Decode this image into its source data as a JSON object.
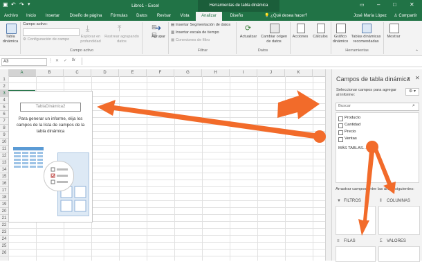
{
  "titlebar": {
    "title": "Libro1 - Excel",
    "context": "Herramientas de tabla dinámica"
  },
  "tabs": [
    "Archivo",
    "Inicio",
    "Insertar",
    "Diseño de página",
    "Fórmulas",
    "Datos",
    "Revisar",
    "Vista",
    "Analizar",
    "Diseño"
  ],
  "active_tab": "Analizar",
  "tell_me": "¿Qué desea hacer?",
  "user": "José María López",
  "share": "Compartir",
  "ribbon": {
    "pivot_label": "Tabla dinámica",
    "active_field_title": "Campo activo:",
    "field_settings": "Configuración de campo",
    "explore_in": "Explorar en profundidad",
    "drill_up": "Rastrear agrupando datos",
    "group_active_field": "Campo activo",
    "group_btn": "Agrupar",
    "insert_slicer": "Insertar Segmentación de datos",
    "insert_timeline": "Insertar escala de tiempo",
    "filter_connections": "Conexiones de filtro",
    "group_filter": "Filtrar",
    "refresh": "Actualizar",
    "change_source": "Cambiar origen de datos",
    "group_data": "Datos",
    "actions": "Acciones",
    "calculations": "Cálculos",
    "pivot_chart": "Gráfico dinámico",
    "recommended": "Tablas dinámicas recomendadas",
    "group_tools": "Herramientas",
    "show": "Mostrar"
  },
  "namebox": "A3",
  "fx": "fx",
  "columns": [
    "A",
    "B",
    "C",
    "D",
    "E",
    "F",
    "G",
    "H",
    "I",
    "J",
    "K"
  ],
  "rows": [
    "1",
    "2",
    "3",
    "4",
    "5",
    "6",
    "7",
    "8",
    "9",
    "10",
    "11",
    "12",
    "13",
    "14",
    "15",
    "16",
    "17",
    "18",
    "19",
    "20",
    "21",
    "22",
    "23",
    "24",
    "25",
    "26"
  ],
  "selected_col": "A",
  "selected_row": "3",
  "pivot": {
    "name": "TablaDinámica2",
    "message": "Para generar un informe, elija los campos de la lista de campos de la tabla dinámica"
  },
  "pane": {
    "title": "Campos de tabla dinámica",
    "instructions": "Seleccionar campos para agregar al informe:",
    "search_placeholder": "Buscar",
    "fields": [
      "Producto",
      "Cantidad",
      "Precio",
      "Ventas"
    ],
    "more_tables": "MÁS TABLAS...",
    "drag_hint": "Arrastrar campos entre las áreas siguientes:",
    "areas": [
      "FILTROS",
      "COLUMNAS",
      "FILAS",
      "VALORES"
    ]
  },
  "colors": {
    "excel_green": "#217346",
    "arrow": "#f26b2a"
  }
}
